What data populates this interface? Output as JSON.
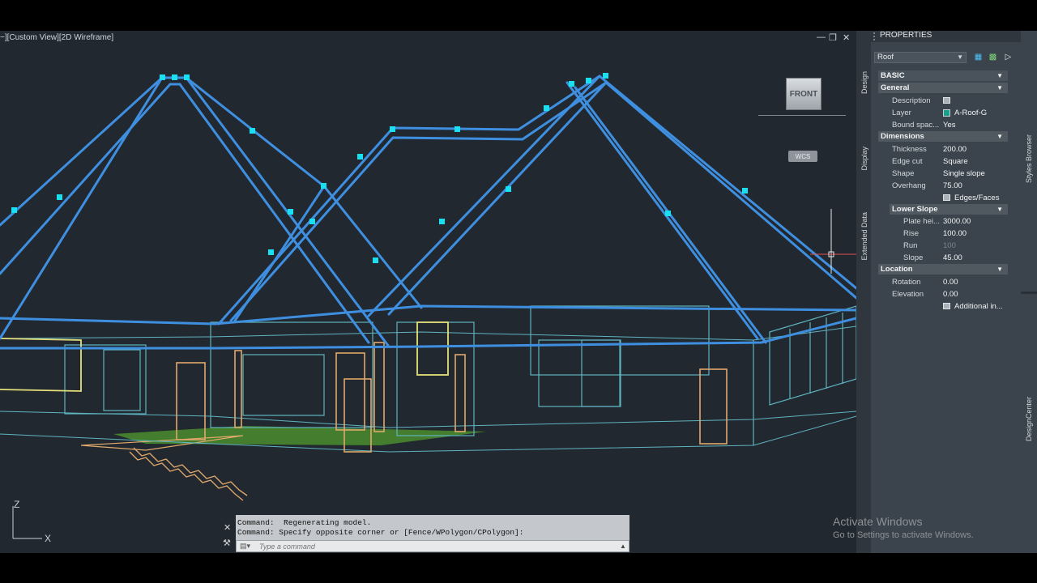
{
  "viewport": {
    "label": "−][Custom View][2D Wireframe]",
    "viewcube_face": "FRONT",
    "wcs_label": "WCS",
    "ucs_axis_z": "Z",
    "ucs_axis_x": "X",
    "window_controls": [
      "minimize-icon",
      "restore-icon",
      "close-icon"
    ]
  },
  "command_line": {
    "history": [
      "Command:  Regenerating model.",
      "Command: Specify opposite corner or [Fence/WPolygon/CPolygon]:"
    ],
    "placeholder": "Type a command"
  },
  "properties": {
    "title": "PROPERTIES",
    "object_type": "Roof",
    "side_tabs": [
      "Design",
      "Display",
      "Extended Data"
    ],
    "basic_label": "BASIC",
    "general": {
      "label": "General",
      "rows": [
        {
          "key": "Description",
          "value": ""
        },
        {
          "key": "Layer",
          "value": "A-Roof-G"
        },
        {
          "key": "Bound spac...",
          "value": "Yes"
        }
      ]
    },
    "dimensions": {
      "label": "Dimensions",
      "rows": [
        {
          "key": "Thickness",
          "value": "200.00"
        },
        {
          "key": "Edge cut",
          "value": "Square"
        },
        {
          "key": "Shape",
          "value": "Single slope"
        },
        {
          "key": "Overhang",
          "value": "75.00"
        },
        {
          "key": "",
          "value": "Edges/Faces"
        }
      ]
    },
    "lower_slope": {
      "label": "Lower Slope",
      "rows": [
        {
          "key": "Plate hei...",
          "value": "3000.00"
        },
        {
          "key": "Rise",
          "value": "100.00"
        },
        {
          "key": "Run",
          "value": "100"
        },
        {
          "key": "Slope",
          "value": "45.00"
        }
      ]
    },
    "location": {
      "label": "Location",
      "rows": [
        {
          "key": "Rotation",
          "value": "0.00"
        },
        {
          "key": "Elevation",
          "value": "0.00"
        },
        {
          "key": "",
          "value": "Additional in..."
        }
      ]
    },
    "layer_color": "#1aa08a"
  },
  "right_tabs": [
    "Styles Browser",
    "DesignCenter"
  ],
  "watermark": {
    "line1": "Activate Windows",
    "line2": "Go to Settings to activate Windows."
  },
  "colors": {
    "roof_selected": "#3f8fe0",
    "grip": "#19e0f0",
    "wall": "#5fb3c0",
    "door": "#e0a86a",
    "window_frame": "#e6e07a",
    "floor": "#5aa832",
    "background": "#212830"
  }
}
